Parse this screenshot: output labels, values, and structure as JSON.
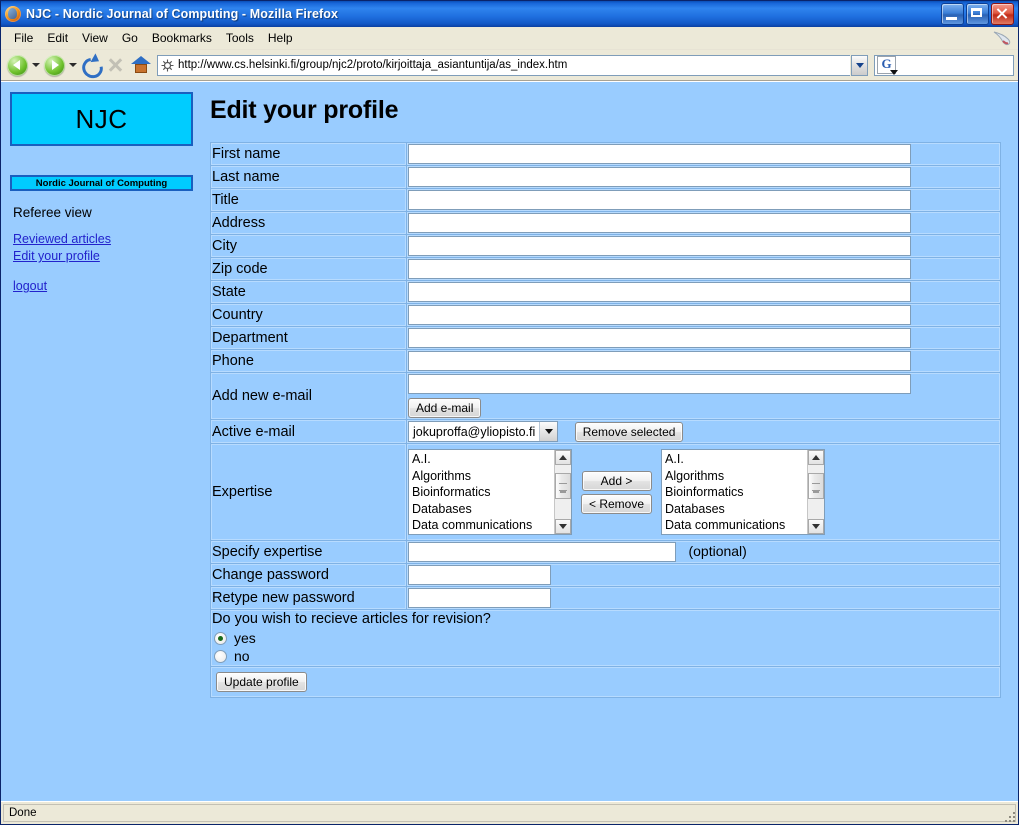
{
  "window": {
    "title": "NJC - Nordic Journal of Computing - Mozilla Firefox",
    "minimize_label": "Minimize",
    "maximize_label": "Maximize",
    "close_label": "Close"
  },
  "menu": [
    {
      "label": "File"
    },
    {
      "label": "Edit"
    },
    {
      "label": "View"
    },
    {
      "label": "Go"
    },
    {
      "label": "Bookmarks"
    },
    {
      "label": "Tools"
    },
    {
      "label": "Help"
    }
  ],
  "toolbar": {
    "back_label": "Back",
    "forward_label": "Forward",
    "reload_label": "Reload",
    "stop_label": "Stop",
    "home_label": "Home",
    "url": "http://www.cs.helsinki.fi/group/njc2/proto/kirjoittaja_asiantuntija/as_index.htm",
    "search_placeholder": "",
    "search_value": "",
    "search_engine_glyph": "G"
  },
  "sidebar": {
    "logo_text": "NJC",
    "subtitle": "Nordic Journal of Computing",
    "role": "Referee view",
    "links": [
      {
        "label": "Reviewed articles"
      },
      {
        "label": "Edit your profile"
      }
    ],
    "logout": {
      "label": "logout"
    }
  },
  "main": {
    "title": "Edit your profile",
    "fields": [
      {
        "label": "First name",
        "value": ""
      },
      {
        "label": "Last name",
        "value": ""
      },
      {
        "label": "Title",
        "value": ""
      },
      {
        "label": "Address",
        "value": ""
      },
      {
        "label": "City",
        "value": ""
      },
      {
        "label": "Zip code",
        "value": ""
      },
      {
        "label": "State",
        "value": ""
      },
      {
        "label": "Country",
        "value": ""
      },
      {
        "label": "Department",
        "value": ""
      },
      {
        "label": "Phone",
        "value": ""
      }
    ],
    "add_email": {
      "label": "Add new e-mail",
      "value": "",
      "button_label": "Add e-mail"
    },
    "active_email": {
      "label": "Active e-mail",
      "selected": "jokuproffa@yliopisto.fi",
      "options": [
        "jokuproffa@yliopisto.fi"
      ],
      "remove_button_label": "Remove selected"
    },
    "expertise": {
      "label": "Expertise",
      "available": [
        "A.I.",
        "Algorithms",
        "Bioinformatics",
        "Databases",
        "Data communications"
      ],
      "selected": [
        "A.I.",
        "Algorithms",
        "Bioinformatics",
        "Databases",
        "Data communications"
      ],
      "add_button_label": "Add >",
      "remove_button_label": "< Remove"
    },
    "specify_expertise": {
      "label": "Specify expertise",
      "value": "",
      "hint": "(optional)"
    },
    "change_password": {
      "label": "Change password",
      "value": ""
    },
    "retype_password": {
      "label": "Retype new password",
      "value": ""
    },
    "revision": {
      "question": "Do you wish to recieve articles for revision?",
      "options": [
        {
          "label": "yes",
          "selected": true
        },
        {
          "label": "no",
          "selected": false
        }
      ]
    },
    "submit": {
      "label": "Update profile"
    }
  },
  "status": {
    "text": "Done"
  }
}
